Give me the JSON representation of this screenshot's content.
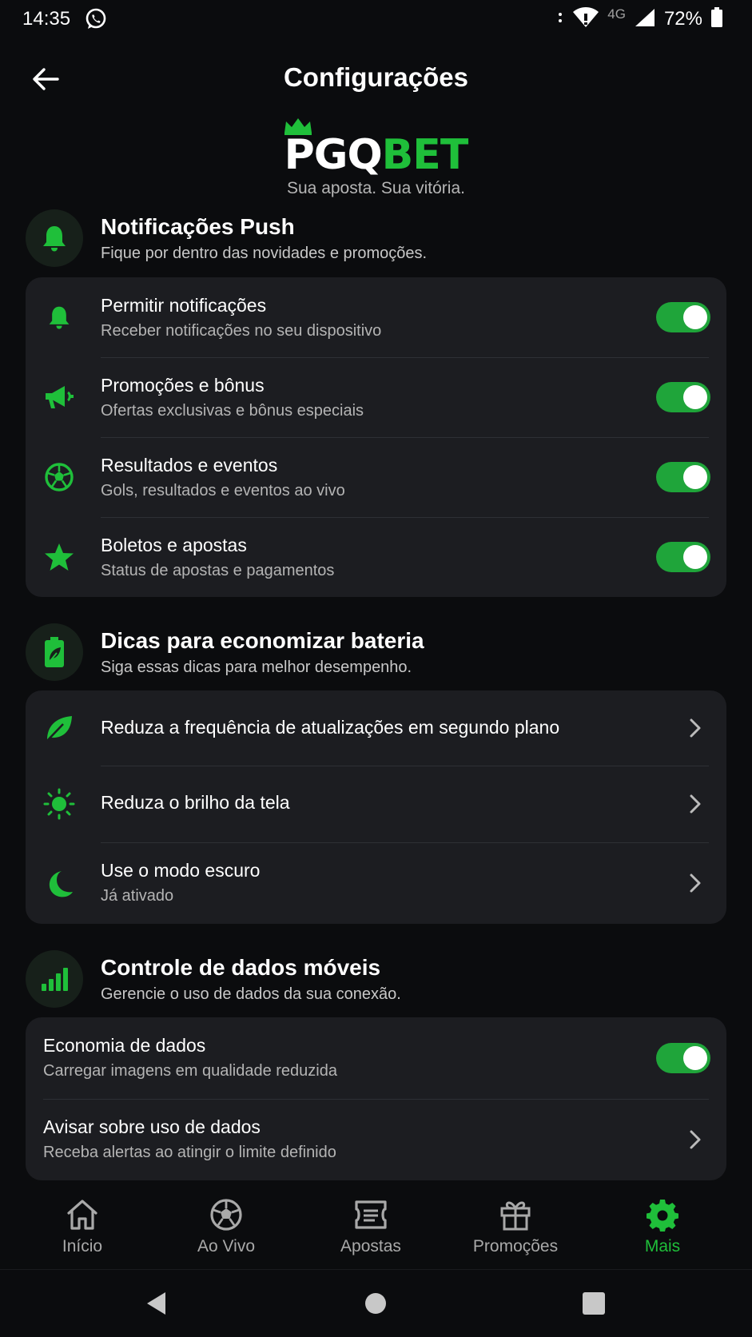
{
  "status_bar": {
    "time": "14:35",
    "network": "4G",
    "battery": "72%"
  },
  "header": {
    "title": "Configurações"
  },
  "logo": {
    "brand_white": "PGQ",
    "brand_green": "BET",
    "tagline": "Sua aposta. Sua vitória."
  },
  "push": {
    "title": "Notificações Push",
    "subtitle": "Fique por dentro das novidades e promoções.",
    "items": [
      {
        "title": "Permitir notificações",
        "subtitle": "Receber notificações no seu dispositivo",
        "icon": "bell-icon",
        "enabled": true
      },
      {
        "title": "Promoções e bônus",
        "subtitle": "Ofertas exclusivas e bônus especiais",
        "icon": "megaphone-icon",
        "enabled": true
      },
      {
        "title": "Resultados e eventos",
        "subtitle": "Gols, resultados e eventos ao vivo",
        "icon": "soccer-ball-icon",
        "enabled": true
      },
      {
        "title": "Boletos e apostas",
        "subtitle": "Status de apostas e pagamentos",
        "icon": "star-icon",
        "enabled": true
      }
    ]
  },
  "battery_tips": {
    "title": "Dicas para economizar bateria",
    "subtitle": "Siga essas dicas para melhor desempenho.",
    "items": [
      {
        "title": "Reduza a frequência de atualizações em segundo plano",
        "icon": "leaf-icon"
      },
      {
        "title": "Reduza o brilho da tela",
        "icon": "sun-icon"
      },
      {
        "title": "Use o modo escuro",
        "subtitle": "Já ativado",
        "icon": "moon-icon"
      }
    ]
  },
  "mobile_data": {
    "title": "Controle de dados móveis",
    "subtitle": "Gerencie o uso de dados da sua conexão.",
    "items": [
      {
        "title": "Economia de dados",
        "subtitle": "Carregar imagens em qualidade reduzida",
        "enabled": true
      },
      {
        "title": "Avisar sobre uso de dados",
        "subtitle": "Receba alertas ao atingir o limite definido"
      }
    ]
  },
  "bottom_nav": {
    "items": [
      {
        "label": "Início",
        "icon": "home-icon"
      },
      {
        "label": "Ao Vivo",
        "icon": "soccer-ball-icon"
      },
      {
        "label": "Apostas",
        "icon": "ticket-icon"
      },
      {
        "label": "Promoções",
        "icon": "gift-icon"
      },
      {
        "label": "Mais",
        "icon": "gear-icon",
        "active": true
      }
    ]
  },
  "colors": {
    "accent": "#1fbf3a",
    "background": "#0b0c0e",
    "card": "#1c1d21"
  }
}
